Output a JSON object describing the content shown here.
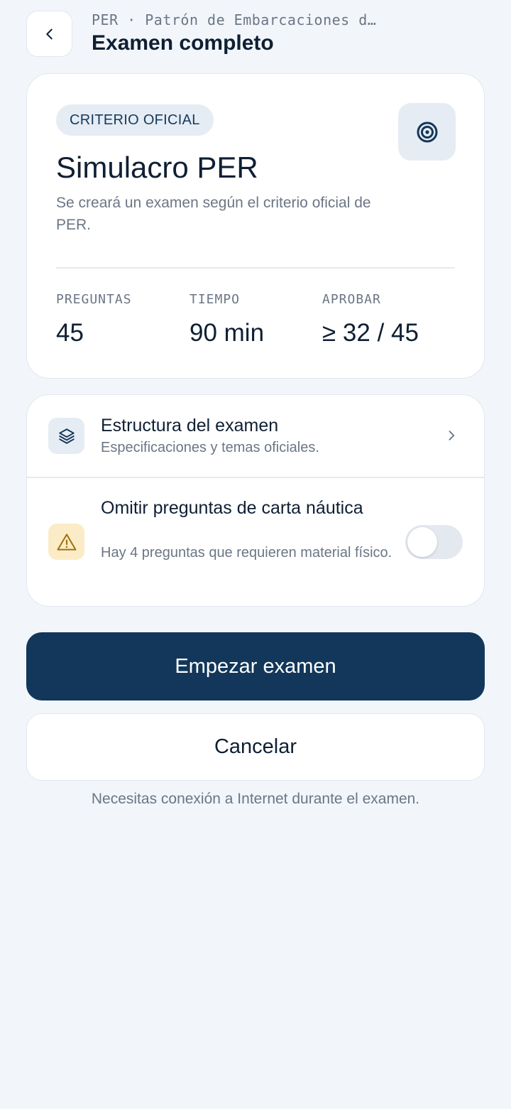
{
  "header": {
    "back_icon": "chevron-left-icon",
    "breadcrumb": "PER · Patrón de Embarcaciones d…",
    "title": "Examen completo"
  },
  "summary": {
    "badge": "CRITERIO OFICIAL",
    "icon": "target-icon",
    "title": "Simulacro PER",
    "description": "Se creará un examen según el criterio oficial de PER.",
    "stats": [
      {
        "label": "PREGUNTAS",
        "value": "45"
      },
      {
        "label": "TIEMPO",
        "value": "90 min"
      },
      {
        "label": "APROBAR",
        "value": "≥ 32 / 45"
      }
    ]
  },
  "options": {
    "structure": {
      "icon": "layers-icon",
      "title": "Estructura del examen",
      "subtitle": "Especificaciones y temas oficiales.",
      "trailing_icon": "chevron-right-icon"
    },
    "skip_chart": {
      "icon": "warning-icon",
      "title": "Omitir preguntas de carta náutica",
      "subtitle": "Hay 4 preguntas que requieren material físico.",
      "enabled": false
    }
  },
  "actions": {
    "start_label": "Empezar examen",
    "cancel_label": "Cancelar"
  },
  "footnote": "Necesitas conexión a Internet durante el examen.",
  "colors": {
    "background": "#f2f6fa",
    "primary": "#13375a",
    "text": "#0f1f33",
    "muted": "#6b7685",
    "warning_bg": "#fbecc7",
    "warning_icon": "#a0700d"
  }
}
